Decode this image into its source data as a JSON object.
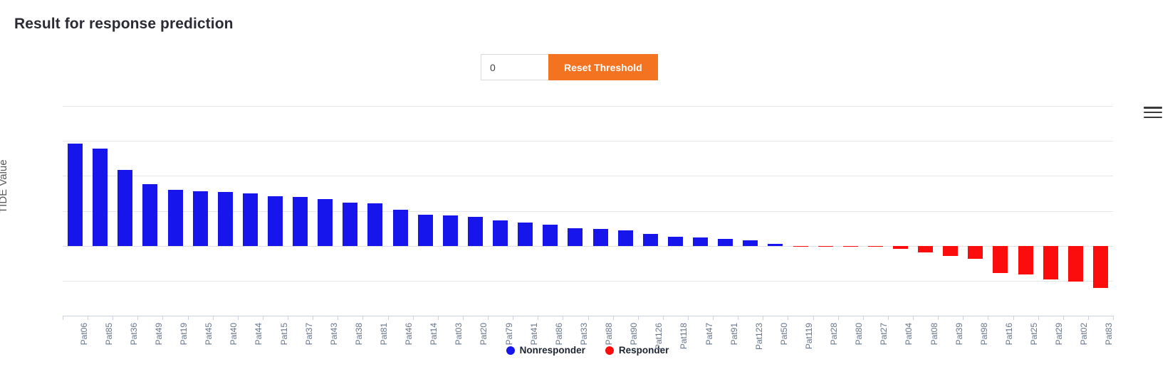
{
  "page_title": "Result for response prediction",
  "controls": {
    "threshold_value": "0",
    "threshold_placeholder": "0",
    "reset_label": "Reset Threshold",
    "accent_color": "#f37321"
  },
  "chart_menu": {
    "icon": "hamburger-menu-icon"
  },
  "legend": {
    "position": "bottom-center",
    "items": [
      {
        "label": "Nonresponder",
        "color": "#1616ec"
      },
      {
        "label": "Responder",
        "color": "#fc0d0d"
      }
    ]
  },
  "chart_data": {
    "type": "bar",
    "title": "Result for response prediction",
    "xlabel": "",
    "ylabel": "TIDE Value",
    "ylim": [
      -2,
      4
    ],
    "yticks": [
      4,
      3,
      2,
      1,
      0,
      -1,
      -2
    ],
    "grid": true,
    "threshold": 0,
    "positive_color": "#1616ec",
    "negative_color": "#fc0d0d",
    "categories": [
      "Pat06",
      "Pat85",
      "Pat36",
      "Pat49",
      "Pat19",
      "Pat45",
      "Pat40",
      "Pat44",
      "Pat15",
      "Pat37",
      "Pat43",
      "Pat38",
      "Pat81",
      "Pat46",
      "Pat14",
      "Pat03",
      "Pat20",
      "Pat79",
      "Pat41",
      "Pat86",
      "Pat33",
      "Pat88",
      "Pat90",
      "Pat126",
      "Pat118",
      "Pat47",
      "Pat91",
      "Pat123",
      "Pat50",
      "Pat119",
      "Pat28",
      "Pat80",
      "Pat27",
      "Pat04",
      "Pat08",
      "Pat39",
      "Pat98",
      "Pat16",
      "Pat25",
      "Pat29",
      "Pat02",
      "Pat83"
    ],
    "values": [
      2.92,
      2.78,
      2.17,
      1.77,
      1.59,
      1.56,
      1.54,
      1.5,
      1.42,
      1.4,
      1.33,
      1.24,
      1.22,
      1.04,
      0.89,
      0.87,
      0.82,
      0.72,
      0.67,
      0.61,
      0.51,
      0.49,
      0.45,
      0.33,
      0.25,
      0.24,
      0.2,
      0.16,
      0.05,
      -0.01,
      -0.01,
      -0.01,
      -0.03,
      -0.09,
      -0.19,
      -0.29,
      -0.38,
      -0.78,
      -0.82,
      -0.97,
      -1.02,
      -1.2
    ],
    "series": [
      {
        "name": "Nonresponder",
        "color": "#1616ec",
        "rule": "value > 0"
      },
      {
        "name": "Responder",
        "color": "#fc0d0d",
        "rule": "value <= 0"
      }
    ]
  }
}
